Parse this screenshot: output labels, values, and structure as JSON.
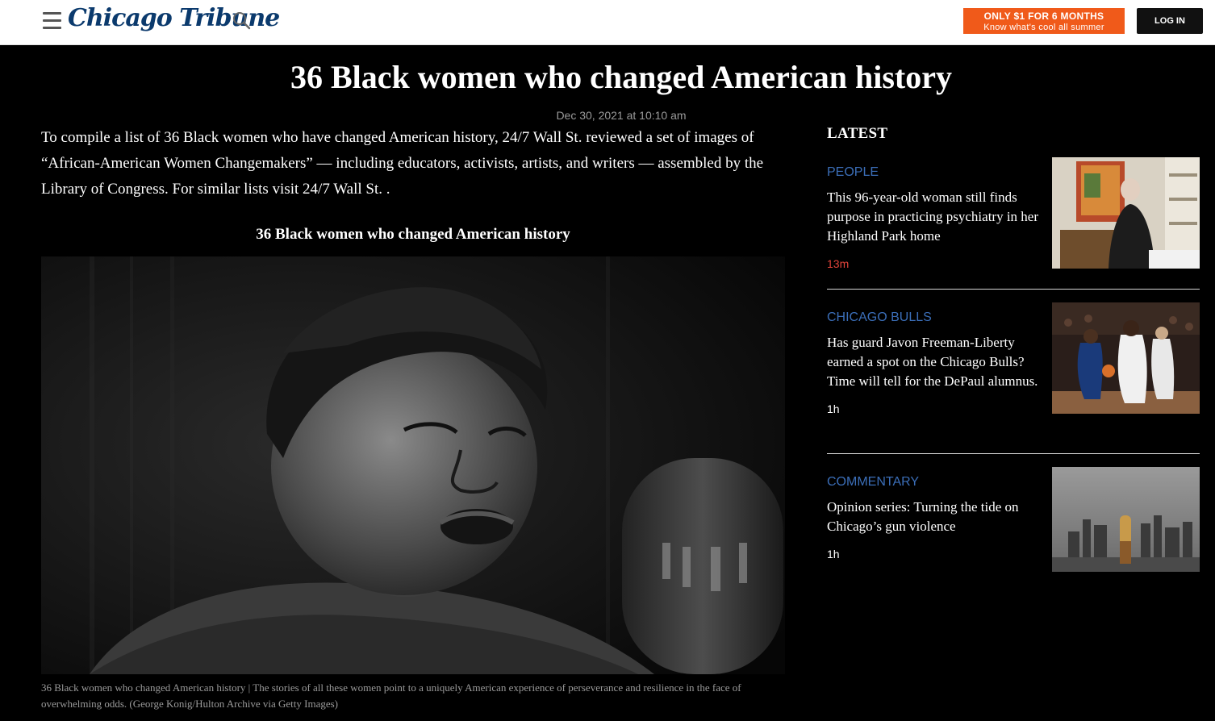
{
  "header": {
    "logo": "Chicago Tribune",
    "promo_line1": "ONLY $1 FOR 6 MONTHS",
    "promo_line2": "Know what's cool all summer",
    "login": "LOG IN"
  },
  "article": {
    "headline": "36 Black women who changed American history",
    "date": "Dec 30, 2021 at 10:10 am",
    "intro": "To compile a list of 36 Black women who have changed American history, 24/7 Wall St. reviewed a set of images of “African-American Women Changemakers” — including educators, activists, artists, and writers — assembled by the Library of Congress. For similar lists visit 24/7 Wall St. .",
    "subhead": "36 Black women who changed American history",
    "caption": "36 Black women who changed American history | The stories of all these women point to a uniquely American experience of perseverance and resilience in the face of overwhelming odds. (George Konig/Hulton Archive via Getty Images)"
  },
  "latest": {
    "title": "LATEST",
    "items": [
      {
        "section": "PEOPLE",
        "title": "This 96-year-old woman still finds purpose in practicing psychiatry in her Highland Park home",
        "age": "13m",
        "age_color": "#e0443a"
      },
      {
        "section": "CHICAGO BULLS",
        "title": "Has guard Javon Freeman-Liberty earned a spot on the Chicago Bulls? Time will tell for the DePaul alumnus.",
        "age": "1h",
        "age_color": "#ffffff"
      },
      {
        "section": "COMMENTARY",
        "title": "Opinion series: Turning the tide on Chicago’s gun violence",
        "age": "1h",
        "age_color": "#ffffff"
      }
    ]
  },
  "colors": {
    "brand": "#0b3a6d",
    "promo": "#f05a1a",
    "section_link": "#3b6eb8"
  }
}
